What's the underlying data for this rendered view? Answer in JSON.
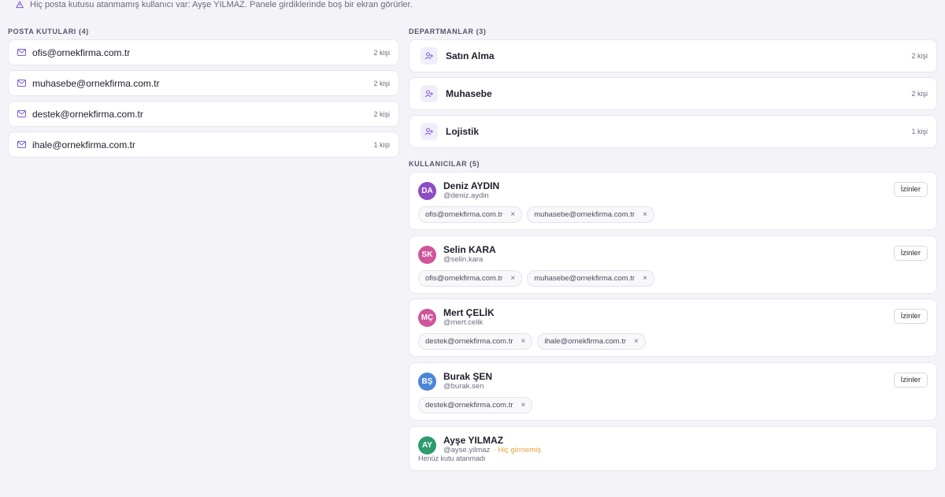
{
  "warning": "Hiç posta kutusu atanmamış kullanıcı var: Ayşe YILMAZ. Panele girdiklerinde boş bir ekran görürler.",
  "mailboxes": {
    "title": "POSTA KUTULARI (4)",
    "items": [
      {
        "address": "ofis@ornekfirma.com.tr",
        "count": "2 kişi"
      },
      {
        "address": "muhasebe@ornekfirma.com.tr",
        "count": "2 kişi"
      },
      {
        "address": "destek@ornekfirma.com.tr",
        "count": "2 kişi"
      },
      {
        "address": "ihale@ornekfirma.com.tr",
        "count": "1 kişi"
      }
    ]
  },
  "departments": {
    "title": "DEPARTMANLAR (3)",
    "items": [
      {
        "name": "Satın Alma",
        "count": "2 kişi"
      },
      {
        "name": "Muhasebe",
        "count": "2 kişi"
      },
      {
        "name": "Lojistik",
        "count": "1 kişi"
      }
    ]
  },
  "users": {
    "title": "KULLANICILAR (5)",
    "permissions_label": "İzinler",
    "items": [
      {
        "initials": "DA",
        "name": "Deniz AYDIN",
        "handle": "@deniz.aydin",
        "avatar_color": "#8e4cc4",
        "chips": [
          "ofis@ornekfirma.com.tr",
          "muhasebe@ornekfirma.com.tr"
        ]
      },
      {
        "initials": "SK",
        "name": "Selin KARA",
        "handle": "@selin.kara",
        "avatar_color": "#d0559a",
        "chips": [
          "ofis@ornekfirma.com.tr",
          "muhasebe@ornekfirma.com.tr"
        ]
      },
      {
        "initials": "MÇ",
        "name": "Mert ÇELİK",
        "handle": "@mert.celik",
        "avatar_color": "#d0559a",
        "chips": [
          "destek@ornekfirma.com.tr",
          "ihale@ornekfirma.com.tr"
        ]
      },
      {
        "initials": "BŞ",
        "name": "Burak ŞEN",
        "handle": "@burak.sen",
        "avatar_color": "#4a86d6",
        "chips": [
          "destek@ornekfirma.com.tr"
        ]
      },
      {
        "initials": "AY",
        "name": "Ayşe YILMAZ",
        "handle": "@ayse.yilmaz",
        "avatar_color": "#2e9a6e",
        "status": "· Hiç girmemiş",
        "note": "Henüz kutu atanmadı"
      }
    ]
  },
  "chip_remove": "×",
  "colors": {
    "accent": "#7c5cd6",
    "warning_text": "#e8a13a"
  }
}
